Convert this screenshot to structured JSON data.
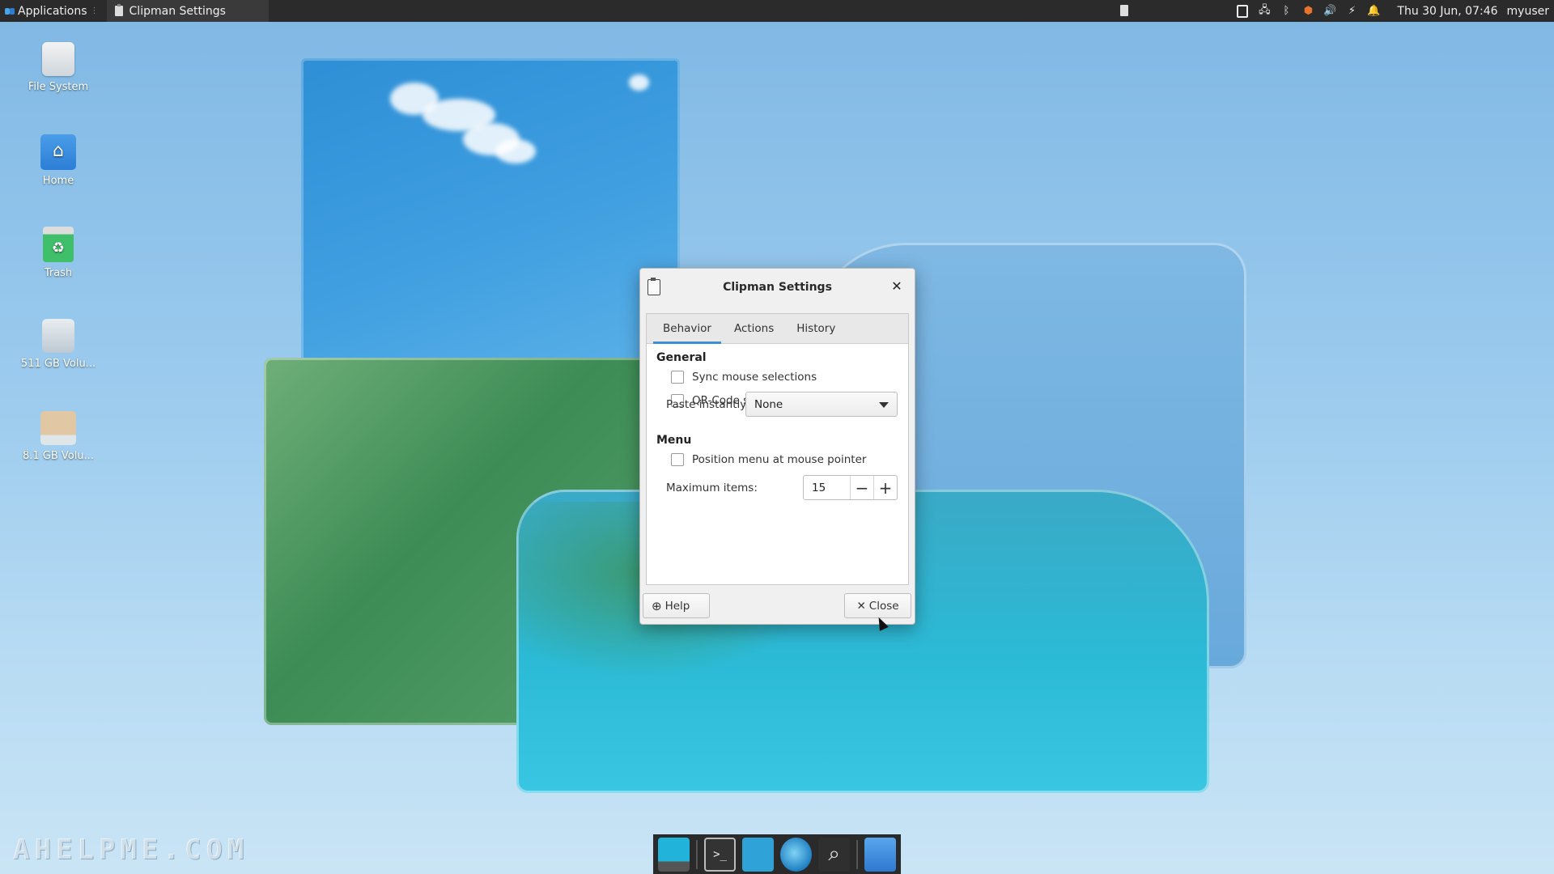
{
  "top_panel": {
    "applications_label": "Applications",
    "task_title": "Clipman Settings",
    "clock": "Thu 30 Jun, 07:46",
    "user": "myuser",
    "tray_icons": [
      "clipboard-icon",
      "network-icon",
      "bluetooth-icon",
      "updates-shield-icon",
      "volume-icon",
      "power-icon",
      "notification-bell-icon"
    ]
  },
  "desktop": {
    "icons": [
      {
        "label": "File System",
        "icon": "drive-icon"
      },
      {
        "label": "Home",
        "icon": "home-folder-icon"
      },
      {
        "label": "Trash",
        "icon": "trash-icon"
      },
      {
        "label": "511 GB Volu...",
        "icon": "volume-icon"
      },
      {
        "label": "8.1 GB Volu...",
        "icon": "usb-drive-icon"
      }
    ],
    "watermark": "AHELPME.COM"
  },
  "dialog": {
    "title": "Clipman Settings",
    "tabs": [
      {
        "label": "Behavior",
        "active": true
      },
      {
        "label": "Actions",
        "active": false
      },
      {
        "label": "History",
        "active": false
      }
    ],
    "general": {
      "heading": "General",
      "sync_mouse_selections": {
        "label": "Sync mouse selections",
        "checked": false
      },
      "qr_code_support": {
        "label": "QR-Code support",
        "checked": false
      },
      "paste_instantly_label": "Paste instantly:",
      "paste_instantly_value": "None"
    },
    "menu": {
      "heading": "Menu",
      "position_menu": {
        "label": "Position menu at mouse pointer",
        "checked": false
      },
      "max_items_label": "Maximum items:",
      "max_items_value": "15"
    },
    "help_label": "Help",
    "close_label": "Close"
  },
  "colors": {
    "panel_bg": "#2b2b2b",
    "accent": "#3d8fd6",
    "dialog_bg": "#f0f0f0"
  }
}
